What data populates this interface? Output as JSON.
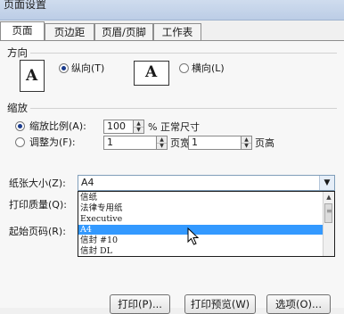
{
  "window": {
    "title": "页面设置"
  },
  "tabs": [
    {
      "label": "页面"
    },
    {
      "label": "页边距"
    },
    {
      "label": "页眉/页脚"
    },
    {
      "label": "工作表"
    }
  ],
  "orientation": {
    "heading": "方向",
    "portrait_label": "纵向(T)",
    "landscape_label": "横向(L)",
    "portrait_icon_letter": "A",
    "landscape_icon_letter": "A",
    "selected": "portrait"
  },
  "scaling": {
    "heading": "缩放",
    "adjust_label": "缩放比例(A):",
    "adjust_value": "100",
    "percent_suffix": "% 正常尺寸",
    "fit_label": "调整为(F):",
    "fit_wide_value": "1",
    "fit_wide_suffix": "页宽",
    "fit_tall_value": "1",
    "fit_tall_suffix": "页高"
  },
  "paper_size": {
    "label": "纸张大小(Z):",
    "value": "A4",
    "options": [
      "信纸",
      "法律专用纸",
      "Executive",
      "A4",
      "信封 #10",
      "信封 DL"
    ],
    "highlighted": "A4"
  },
  "print_quality": {
    "label": "打印质量(Q):"
  },
  "first_page": {
    "label": "起始页码(R):"
  },
  "buttons": {
    "print": "打印(P)...",
    "preview": "打印预览(W)",
    "options": "选项(O)..."
  },
  "colors": {
    "selection": "#3399ff",
    "accent": "#1a3b8c"
  }
}
